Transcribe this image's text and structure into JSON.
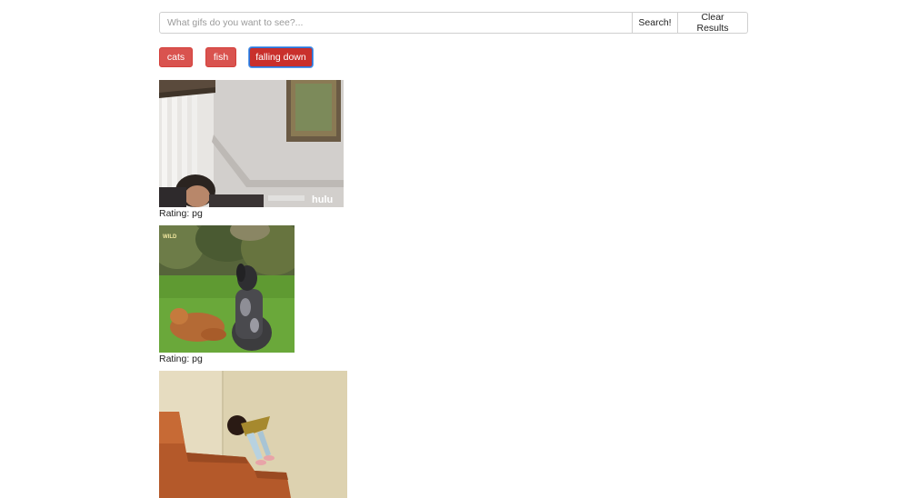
{
  "search": {
    "placeholder": "What gifs do you want to see?...",
    "value": "",
    "search_label": "Search!",
    "clear_label": "Clear Results"
  },
  "topics": [
    {
      "label": "cats",
      "active": false
    },
    {
      "label": "fish",
      "active": false
    },
    {
      "label": "falling down",
      "active": true
    }
  ],
  "colors": {
    "topic_button": "#d9534f",
    "topic_button_active_outline": "#2b6fd6"
  },
  "results": [
    {
      "rating": "Rating: pg",
      "watermark": "hulu"
    },
    {
      "rating": "Rating: pg",
      "watermark": "WILD"
    },
    {
      "rating": ""
    }
  ]
}
